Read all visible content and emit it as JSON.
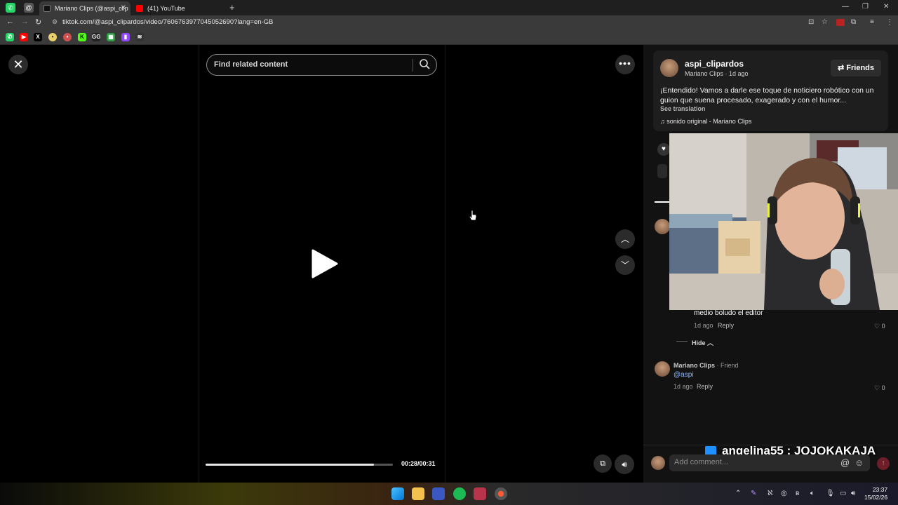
{
  "browser": {
    "tabs": [
      {
        "title": "Mariano Clips (@aspi_clip",
        "active": true
      },
      {
        "title": "(41) YouTube",
        "active": false
      }
    ],
    "url": "tiktok.com/@aspi_clipardos/video/7606763977045052690?lang=en-GB"
  },
  "search": {
    "placeholder": "Find related content"
  },
  "player": {
    "current_time": "00:28",
    "duration": "00:31",
    "time_label": "00:28/00:31",
    "progress_fraction": 0.9
  },
  "description": {
    "username": "aspi_clipardos",
    "subline": "Mariano Clips · 1d ago",
    "friends_label": "Friends",
    "text": "¡Entendido! Vamos a darle ese toque de noticiero robótico con un guion que suena procesado, exagerado y con el humor...",
    "see_translation": "See translation",
    "music": "sonido original - Mariano Clips"
  },
  "comments": {
    "reply_1": {
      "text": "medio boludo el editor",
      "time": "1d ago",
      "reply_label": "Reply",
      "likes": "0"
    },
    "hide_label": "Hide",
    "comment_2": {
      "author": "Mariano Clips",
      "badge": " · Friend",
      "mention": "@aspi",
      "time": "1d ago",
      "reply_label": "Reply",
      "likes": "0"
    }
  },
  "comment_box": {
    "placeholder": "Add comment..."
  },
  "stream_overlay": {
    "text": "angelina55 : JQJQKAKAJA"
  },
  "clock": {
    "time": "23:37",
    "date": "15/02/26"
  },
  "colors": {
    "accent_red": "#fe2c55",
    "link_blue": "#8fb8ff"
  }
}
